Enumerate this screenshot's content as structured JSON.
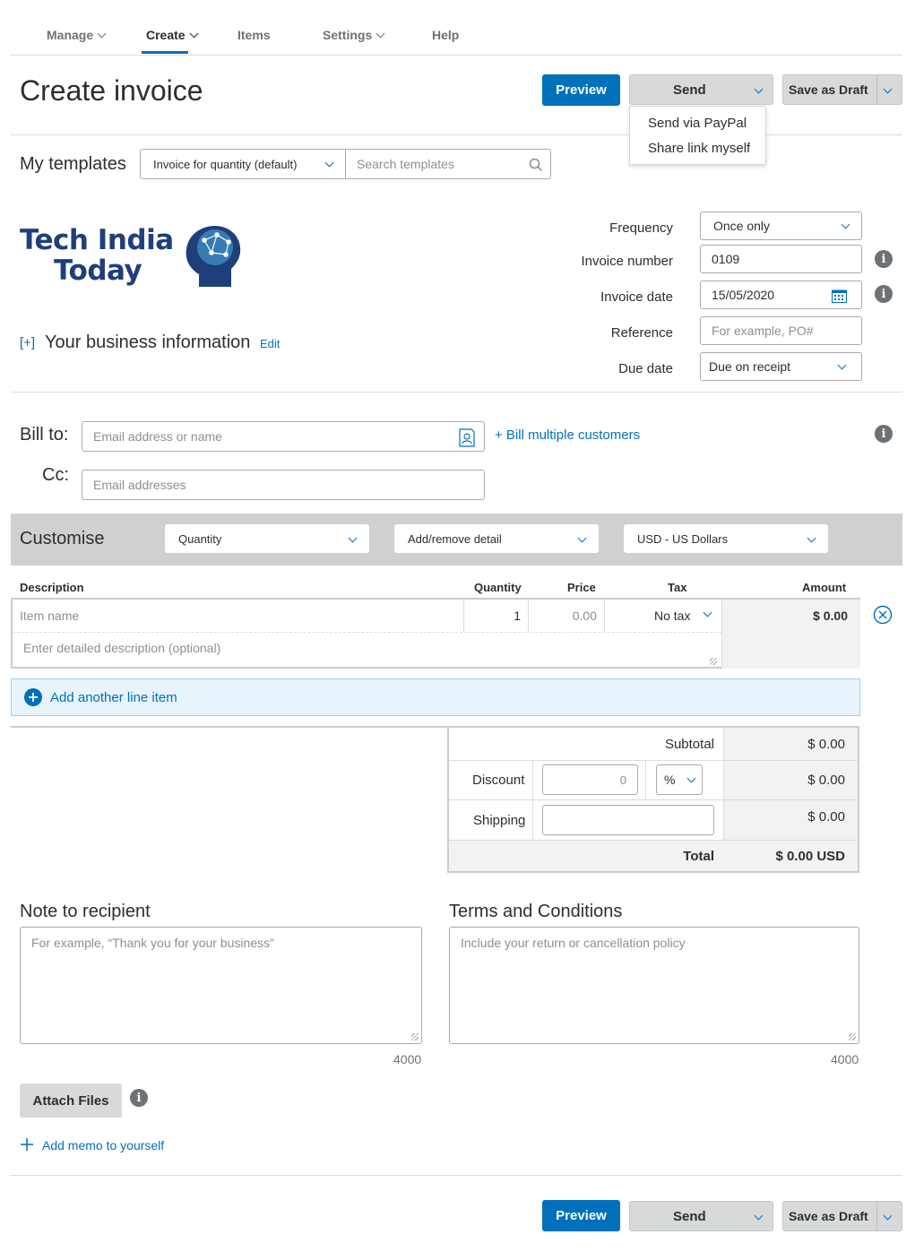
{
  "nav": {
    "items": [
      {
        "label": "Manage",
        "dropdown": true
      },
      {
        "label": "Create",
        "dropdown": true,
        "active": true
      },
      {
        "label": "Items",
        "dropdown": false
      },
      {
        "label": "Settings",
        "dropdown": true
      },
      {
        "label": "Help",
        "dropdown": false
      }
    ]
  },
  "header": {
    "title": "Create invoice",
    "preview_label": "Preview",
    "send_label": "Send",
    "save_draft_label": "Save as Draft",
    "send_menu": [
      "Send via PayPal",
      "Share link myself"
    ]
  },
  "templates": {
    "label": "My templates",
    "selected": "Invoice for quantity (default)",
    "search_placeholder": "Search templates"
  },
  "logo": {
    "line1": "Tech India",
    "line2": "Today"
  },
  "business": {
    "expand": "[+]",
    "label": "Your business information",
    "edit": "Edit"
  },
  "invoice_meta": {
    "frequency_label": "Frequency",
    "frequency_value": "Once only",
    "number_label": "Invoice number",
    "number_value": "0109",
    "date_label": "Invoice date",
    "date_value": "15/05/2020",
    "reference_label": "Reference",
    "reference_placeholder": "For example, PO#",
    "due_label": "Due date",
    "due_value": "Due on receipt"
  },
  "bill": {
    "bill_to_label": "Bill to:",
    "bill_to_placeholder": "Email address or name",
    "multiple": "+ Bill multiple customers",
    "cc_label": "Cc:",
    "cc_placeholder": "Email addresses"
  },
  "customise": {
    "label": "Customise",
    "quantity": "Quantity",
    "detail": "Add/remove detail",
    "currency": "USD - US Dollars"
  },
  "table": {
    "headers": {
      "description": "Description",
      "quantity": "Quantity",
      "price": "Price",
      "tax": "Tax",
      "amount": "Amount"
    },
    "row": {
      "item_placeholder": "Item name",
      "quantity": "1",
      "price_placeholder": "0.00",
      "tax": "No tax",
      "amount": "$ 0.00",
      "description_placeholder": "Enter detailed description (optional)"
    },
    "add_line": "Add another line item"
  },
  "totals": {
    "subtotal_label": "Subtotal",
    "subtotal_value": "$ 0.00",
    "discount_label": "Discount",
    "discount_placeholder": "0",
    "discount_unit": "%",
    "discount_value": "$ 0.00",
    "shipping_label": "Shipping",
    "shipping_value": "$ 0.00",
    "total_label": "Total",
    "total_value": "$ 0.00 USD"
  },
  "note": {
    "label": "Note to recipient",
    "placeholder": "For example, “Thank you for your business”",
    "counter": "4000"
  },
  "terms": {
    "label": "Terms and Conditions",
    "placeholder": "Include your return or cancellation policy",
    "counter": "4000"
  },
  "attach": {
    "label": "Attach Files"
  },
  "memo": {
    "label": "Add memo to yourself"
  },
  "footer": {
    "preview_label": "Preview",
    "send_label": "Send",
    "save_draft_label": "Save as Draft"
  },
  "colors": {
    "primary": "#0070ba",
    "grey_button": "#d7d9da",
    "customise_bar": "#cfd0d1"
  }
}
